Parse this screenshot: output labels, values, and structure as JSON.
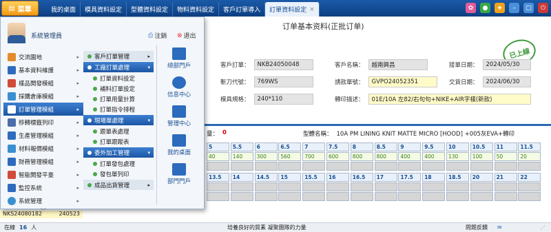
{
  "topbar": {
    "menu_label": "菜單",
    "tabs": [
      "我的桌面",
      "模具資料設定",
      "型體資料設定",
      "物料資料設定",
      "客戶訂單導入",
      "訂單資料設定"
    ]
  },
  "form": {
    "title": "订单基本资料(正批订单)",
    "stamp": "已上線",
    "rows": [
      {
        "label": "客戶訂單：",
        "value": "NKB24050048"
      },
      {
        "label": "客戶名稱：",
        "value": "越南興昌"
      },
      {
        "label": "接單日期：",
        "value": "2024/05/30"
      },
      {
        "label": "斬刀代號：",
        "value": "769WS"
      },
      {
        "label": "請款單號：",
        "value": "GVPO24052351"
      },
      {
        "label": "交貨日期：",
        "value": "2024/06/30"
      },
      {
        "label": "模具規格：",
        "value": "240*110"
      },
      {
        "label": "轉印描述：",
        "value": "01E/10A 左82/右句句+NIKE+AIR字樣(新款)"
      }
    ],
    "qty_label": "量：",
    "qty_value": "0",
    "type_label": "型體名稱：",
    "type_value": "10A PM LINING KNIT MATTE MICRO [HOOD] +005灰EVA+轉印"
  },
  "grid": {
    "sizes_row1": [
      "5",
      "5.5",
      "6",
      "6.5",
      "7",
      "7.5",
      "8",
      "8.5",
      "9",
      "9.5",
      "10",
      "10.5",
      "11",
      "11.5"
    ],
    "values_row1": [
      "40",
      "140",
      "300",
      "560",
      "700",
      "600",
      "800",
      "800",
      "400",
      "400",
      "130",
      "100",
      "50",
      "20"
    ],
    "sizes_row2": [
      "13.5",
      "14",
      "14.5",
      "15",
      "15.5",
      "16",
      "16.5",
      "17",
      "17.5",
      "18",
      "18.5",
      "20",
      "21",
      "22"
    ]
  },
  "popup": {
    "user_name": "系統管理員",
    "logout_label": "注銷",
    "exit_label": "退出",
    "col1": [
      "交流園地",
      "基本資料維護",
      "樣品開發模組",
      "採購倉庫模組",
      "訂單管理模組",
      "移轉標籤列印",
      "生產管理模組",
      "材料報價模組",
      "財務管理模組",
      "智能開發平臺",
      "監控系統",
      "系統管理"
    ],
    "col2": {
      "h1": "客戶訂單管理",
      "h2": "工廠訂單處理",
      "h2_items": [
        "訂單資料設定",
        "補料訂單設定",
        "訂單用量計算",
        "訂單指令排程"
      ],
      "h3": "現場單處理",
      "h3_items": [
        "跟單表處理",
        "訂單跟蹤表"
      ],
      "h4": "委外加工管理",
      "h4_items": [
        "訂單發包處理",
        "發包單列印"
      ],
      "h5": "成品出貨管理"
    },
    "col3": [
      "總部門戶",
      "信息中心",
      "管理中心",
      "我的桌面",
      "部門門戶"
    ]
  },
  "left_row": {
    "order": "NKS24080182",
    "num": "240523"
  },
  "status": {
    "online_label": "在線",
    "online_count": "16",
    "online_unit": "人",
    "slogan": "培養良好的質素 凝聚團隊的力量",
    "feedback": "問題反饋"
  }
}
